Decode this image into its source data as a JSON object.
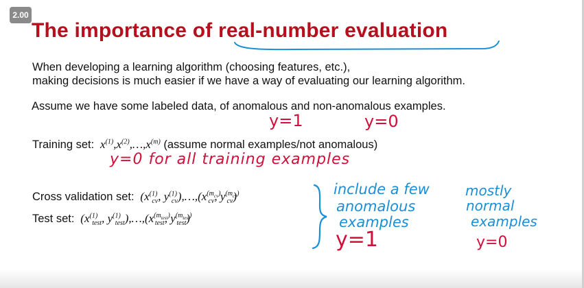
{
  "badge": "2.00",
  "title": "The importance of real-number evaluation",
  "intro_line1": "When developing a learning algorithm (choosing features, etc.),",
  "intro_line2": "making decisions is much easier if we have a way of evaluating our learning algorithm.",
  "assume": "Assume we have some labeled data, of anomalous and non-anomalous examples.",
  "hw_y1": "y=1",
  "hw_y0": "y=0",
  "training_label": "Training set:",
  "training_note": "(assume normal examples/not anomalous)",
  "hw_training": "y=0 for all training examples",
  "cv_label": "Cross validation set:",
  "test_label": "Test set:",
  "hw_include": "include a few",
  "hw_anomalous": "anomalous",
  "hw_examples": "examples",
  "hw_y1_bottom": "y=1",
  "hw_mostly": "mostly",
  "hw_normal": "normal",
  "hw_examples2": "examples",
  "hw_y0_bottom": "y=0",
  "colors": {
    "title": "#b4101e",
    "handwriting_blue": "#1a8fd6",
    "handwriting_red": "#d0103a"
  }
}
